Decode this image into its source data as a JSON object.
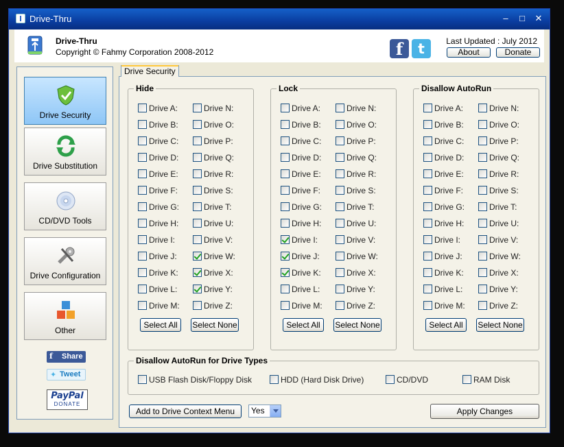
{
  "window": {
    "title": "Drive-Thru"
  },
  "header": {
    "app_name": "Drive-Thru",
    "copyright": "Copyright © Fahmy Corporation 2008-2012",
    "last_updated": "Last Updated : July 2012",
    "about_label": "About",
    "donate_label": "Donate"
  },
  "sidebar": {
    "items": [
      {
        "label": "Drive Security",
        "icon": "shield-check-icon",
        "active": true
      },
      {
        "label": "Drive Substitution",
        "icon": "refresh-arrows-icon",
        "active": false
      },
      {
        "label": "CD/DVD Tools",
        "icon": "disc-icon",
        "active": false
      },
      {
        "label": "Drive Configuration",
        "icon": "tools-icon",
        "active": false
      },
      {
        "label": "Other",
        "icon": "cubes-icon",
        "active": false
      }
    ],
    "share_label": "Share",
    "tweet_label": "Tweet",
    "paypal_label": "PayPal",
    "paypal_sub": "DONATE"
  },
  "tab": {
    "label": "Drive Security"
  },
  "groups": {
    "hide": {
      "title": "Hide",
      "col1": [
        {
          "label": "Drive A:",
          "checked": false
        },
        {
          "label": "Drive B:",
          "checked": false
        },
        {
          "label": "Drive C:",
          "checked": false
        },
        {
          "label": "Drive D:",
          "checked": false
        },
        {
          "label": "Drive E:",
          "checked": false
        },
        {
          "label": "Drive F:",
          "checked": false
        },
        {
          "label": "Drive G:",
          "checked": false
        },
        {
          "label": "Drive H:",
          "checked": false
        },
        {
          "label": "Drive I:",
          "checked": false
        },
        {
          "label": "Drive J:",
          "checked": false
        },
        {
          "label": "Drive K:",
          "checked": false
        },
        {
          "label": "Drive L:",
          "checked": false
        },
        {
          "label": "Drive M:",
          "checked": false
        }
      ],
      "col2": [
        {
          "label": "Drive N:",
          "checked": false
        },
        {
          "label": "Drive O:",
          "checked": false
        },
        {
          "label": "Drive P:",
          "checked": false
        },
        {
          "label": "Drive Q:",
          "checked": false
        },
        {
          "label": "Drive R:",
          "checked": false
        },
        {
          "label": "Drive S:",
          "checked": false
        },
        {
          "label": "Drive T:",
          "checked": false
        },
        {
          "label": "Drive U:",
          "checked": false
        },
        {
          "label": "Drive V:",
          "checked": false
        },
        {
          "label": "Drive W:",
          "checked": true
        },
        {
          "label": "Drive X:",
          "checked": true
        },
        {
          "label": "Drive Y:",
          "checked": true
        },
        {
          "label": "Drive Z:",
          "checked": false
        }
      ],
      "select_all": "Select All",
      "select_none": "Select None"
    },
    "lock": {
      "title": "Lock",
      "col1": [
        {
          "label": "Drive A:",
          "checked": false
        },
        {
          "label": "Drive B:",
          "checked": false
        },
        {
          "label": "Drive C:",
          "checked": false
        },
        {
          "label": "Drive D:",
          "checked": false
        },
        {
          "label": "Drive E:",
          "checked": false
        },
        {
          "label": "Drive F:",
          "checked": false
        },
        {
          "label": "Drive G:",
          "checked": false
        },
        {
          "label": "Drive H:",
          "checked": false
        },
        {
          "label": "Drive I:",
          "checked": true
        },
        {
          "label": "Drive J:",
          "checked": true
        },
        {
          "label": "Drive K:",
          "checked": true
        },
        {
          "label": "Drive L:",
          "checked": false
        },
        {
          "label": "Drive M:",
          "checked": false
        }
      ],
      "col2": [
        {
          "label": "Drive N:",
          "checked": false
        },
        {
          "label": "Drive O:",
          "checked": false
        },
        {
          "label": "Drive P:",
          "checked": false
        },
        {
          "label": "Drive Q:",
          "checked": false
        },
        {
          "label": "Drive R:",
          "checked": false
        },
        {
          "label": "Drive S:",
          "checked": false
        },
        {
          "label": "Drive T:",
          "checked": false
        },
        {
          "label": "Drive U:",
          "checked": false
        },
        {
          "label": "Drive V:",
          "checked": false
        },
        {
          "label": "Drive W:",
          "checked": false
        },
        {
          "label": "Drive X:",
          "checked": false
        },
        {
          "label": "Drive Y:",
          "checked": false
        },
        {
          "label": "Drive Z:",
          "checked": false
        }
      ],
      "select_all": "Select All",
      "select_none": "Select None"
    },
    "autorun": {
      "title": "Disallow AutoRun",
      "col1": [
        {
          "label": "Drive A:",
          "checked": false
        },
        {
          "label": "Drive B:",
          "checked": false
        },
        {
          "label": "Drive C:",
          "checked": false
        },
        {
          "label": "Drive D:",
          "checked": false
        },
        {
          "label": "Drive E:",
          "checked": false
        },
        {
          "label": "Drive F:",
          "checked": false
        },
        {
          "label": "Drive G:",
          "checked": false
        },
        {
          "label": "Drive H:",
          "checked": false
        },
        {
          "label": "Drive I:",
          "checked": false
        },
        {
          "label": "Drive J:",
          "checked": false
        },
        {
          "label": "Drive K:",
          "checked": false
        },
        {
          "label": "Drive L:",
          "checked": false
        },
        {
          "label": "Drive M:",
          "checked": false
        }
      ],
      "col2": [
        {
          "label": "Drive N:",
          "checked": false
        },
        {
          "label": "Drive O:",
          "checked": false
        },
        {
          "label": "Drive P:",
          "checked": false
        },
        {
          "label": "Drive Q:",
          "checked": false
        },
        {
          "label": "Drive R:",
          "checked": false
        },
        {
          "label": "Drive S:",
          "checked": false
        },
        {
          "label": "Drive T:",
          "checked": false
        },
        {
          "label": "Drive U:",
          "checked": false
        },
        {
          "label": "Drive V:",
          "checked": false
        },
        {
          "label": "Drive W:",
          "checked": false
        },
        {
          "label": "Drive X:",
          "checked": false
        },
        {
          "label": "Drive Y:",
          "checked": false
        },
        {
          "label": "Drive Z:",
          "checked": false
        }
      ],
      "select_all": "Select All",
      "select_none": "Select None"
    }
  },
  "drive_types": {
    "title": "Disallow AutoRun for Drive Types",
    "items": [
      {
        "label": "USB Flash Disk/Floppy Disk",
        "checked": false
      },
      {
        "label": "HDD (Hard Disk Drive)",
        "checked": false
      },
      {
        "label": "CD/DVD",
        "checked": false
      },
      {
        "label": "RAM Disk",
        "checked": false
      }
    ]
  },
  "footer": {
    "context_menu_label": "Add to Drive Context Menu",
    "context_menu_value": "Yes",
    "apply_label": "Apply Changes"
  },
  "colors": {
    "titlebar": "#0a3da0",
    "accent": "#ffc83c",
    "check": "#21a121"
  }
}
